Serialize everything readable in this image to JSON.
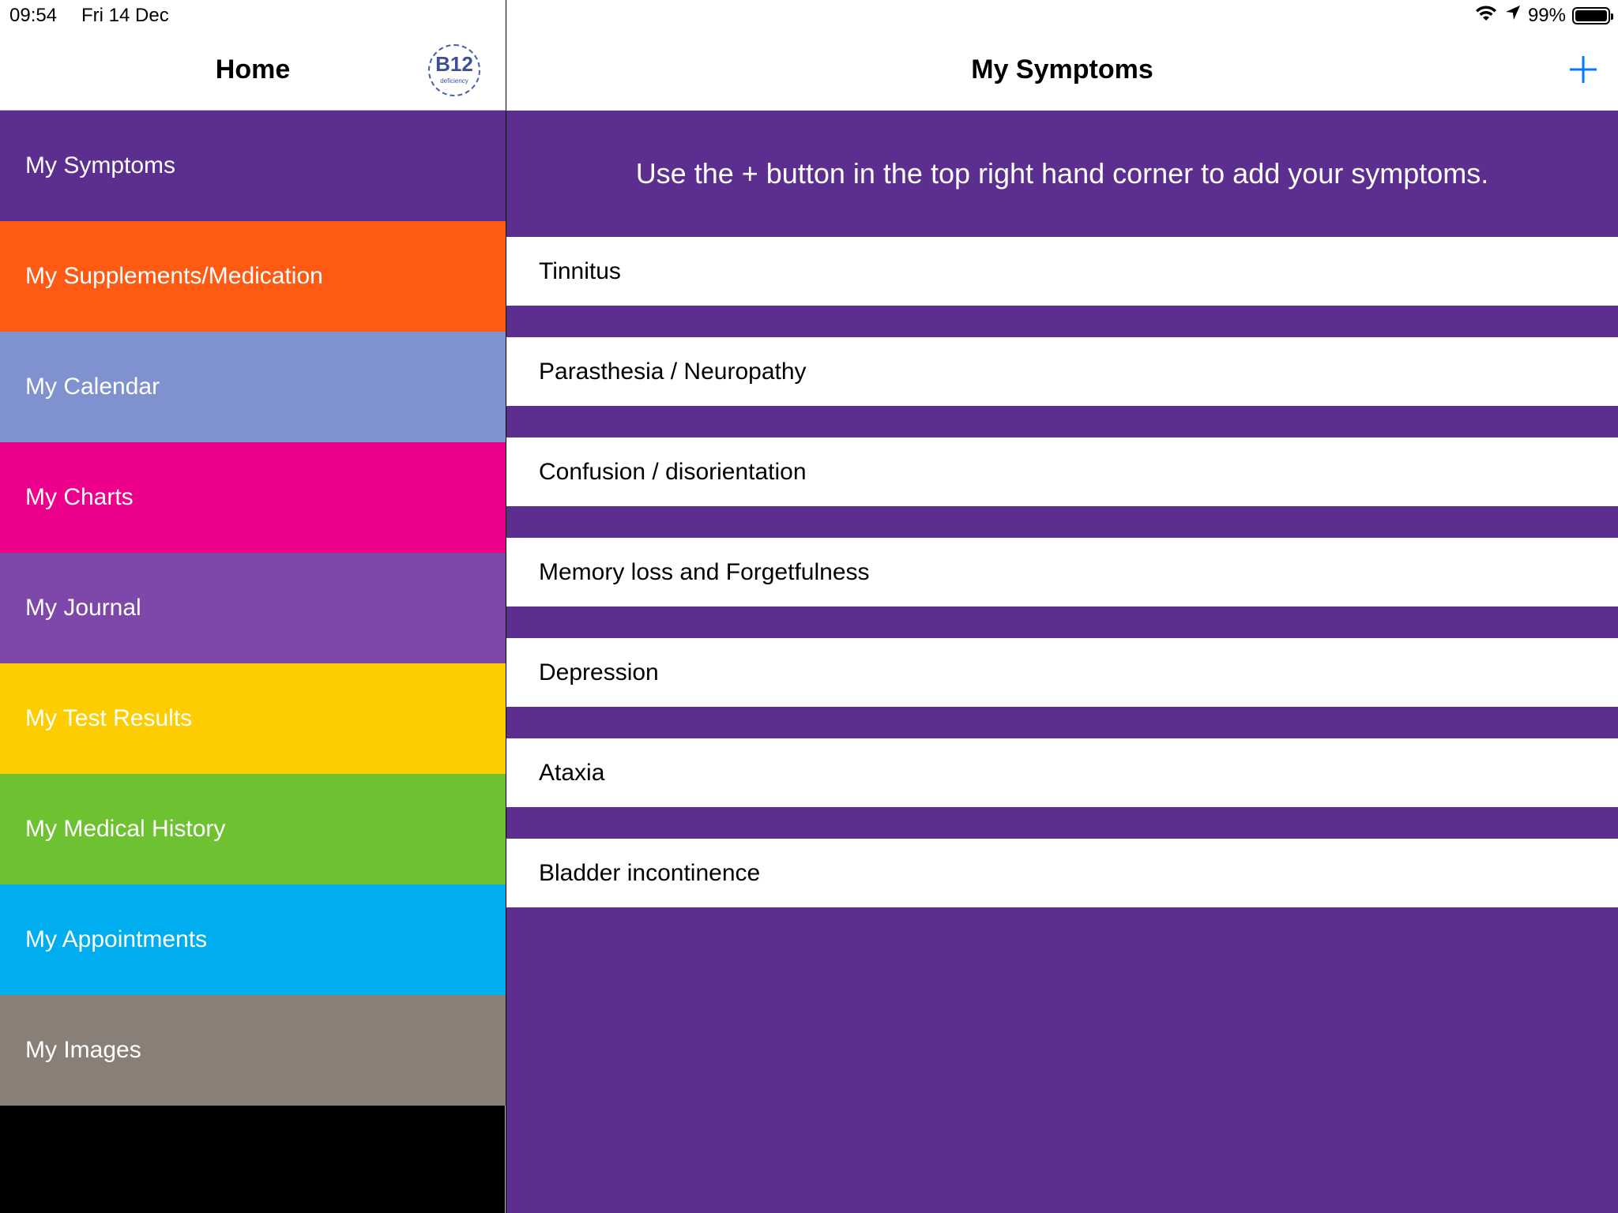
{
  "status_bar": {
    "time": "09:54",
    "date": "Fri 14 Dec",
    "battery_percent": "99%",
    "battery_level": 0.99
  },
  "sidebar": {
    "title": "Home",
    "logo": {
      "main": "B12",
      "sub": "deficiency",
      "color": "#3d4f9c"
    },
    "items": [
      {
        "label": "My Symptoms",
        "color": "#5b2e8f"
      },
      {
        "label": "My Supplements/Medication",
        "color": "#fe5a14"
      },
      {
        "label": "My Calendar",
        "color": "#7f91cf"
      },
      {
        "label": "My Charts",
        "color": "#ec008c"
      },
      {
        "label": "My Journal",
        "color": "#7e48ab"
      },
      {
        "label": "My Test Results",
        "color": "#fecd00"
      },
      {
        "label": "My Medical History",
        "color": "#6ec231"
      },
      {
        "label": "My Appointments",
        "color": "#00aeef"
      },
      {
        "label": "My Images",
        "color": "#8a7f77"
      }
    ]
  },
  "main": {
    "title": "My Symptoms",
    "add_icon": "plus-icon",
    "accent_color": "#007aff",
    "background_color": "#5b2e8f",
    "instruction": "Use the + button in the top right hand corner to add your symptoms.",
    "symptoms": [
      {
        "label": "Tinnitus"
      },
      {
        "label": "Parasthesia / Neuropathy"
      },
      {
        "label": "Confusion / disorientation"
      },
      {
        "label": "Memory loss and Forgetfulness"
      },
      {
        "label": "Depression"
      },
      {
        "label": "Ataxia"
      },
      {
        "label": "Bladder incontinence"
      }
    ]
  }
}
